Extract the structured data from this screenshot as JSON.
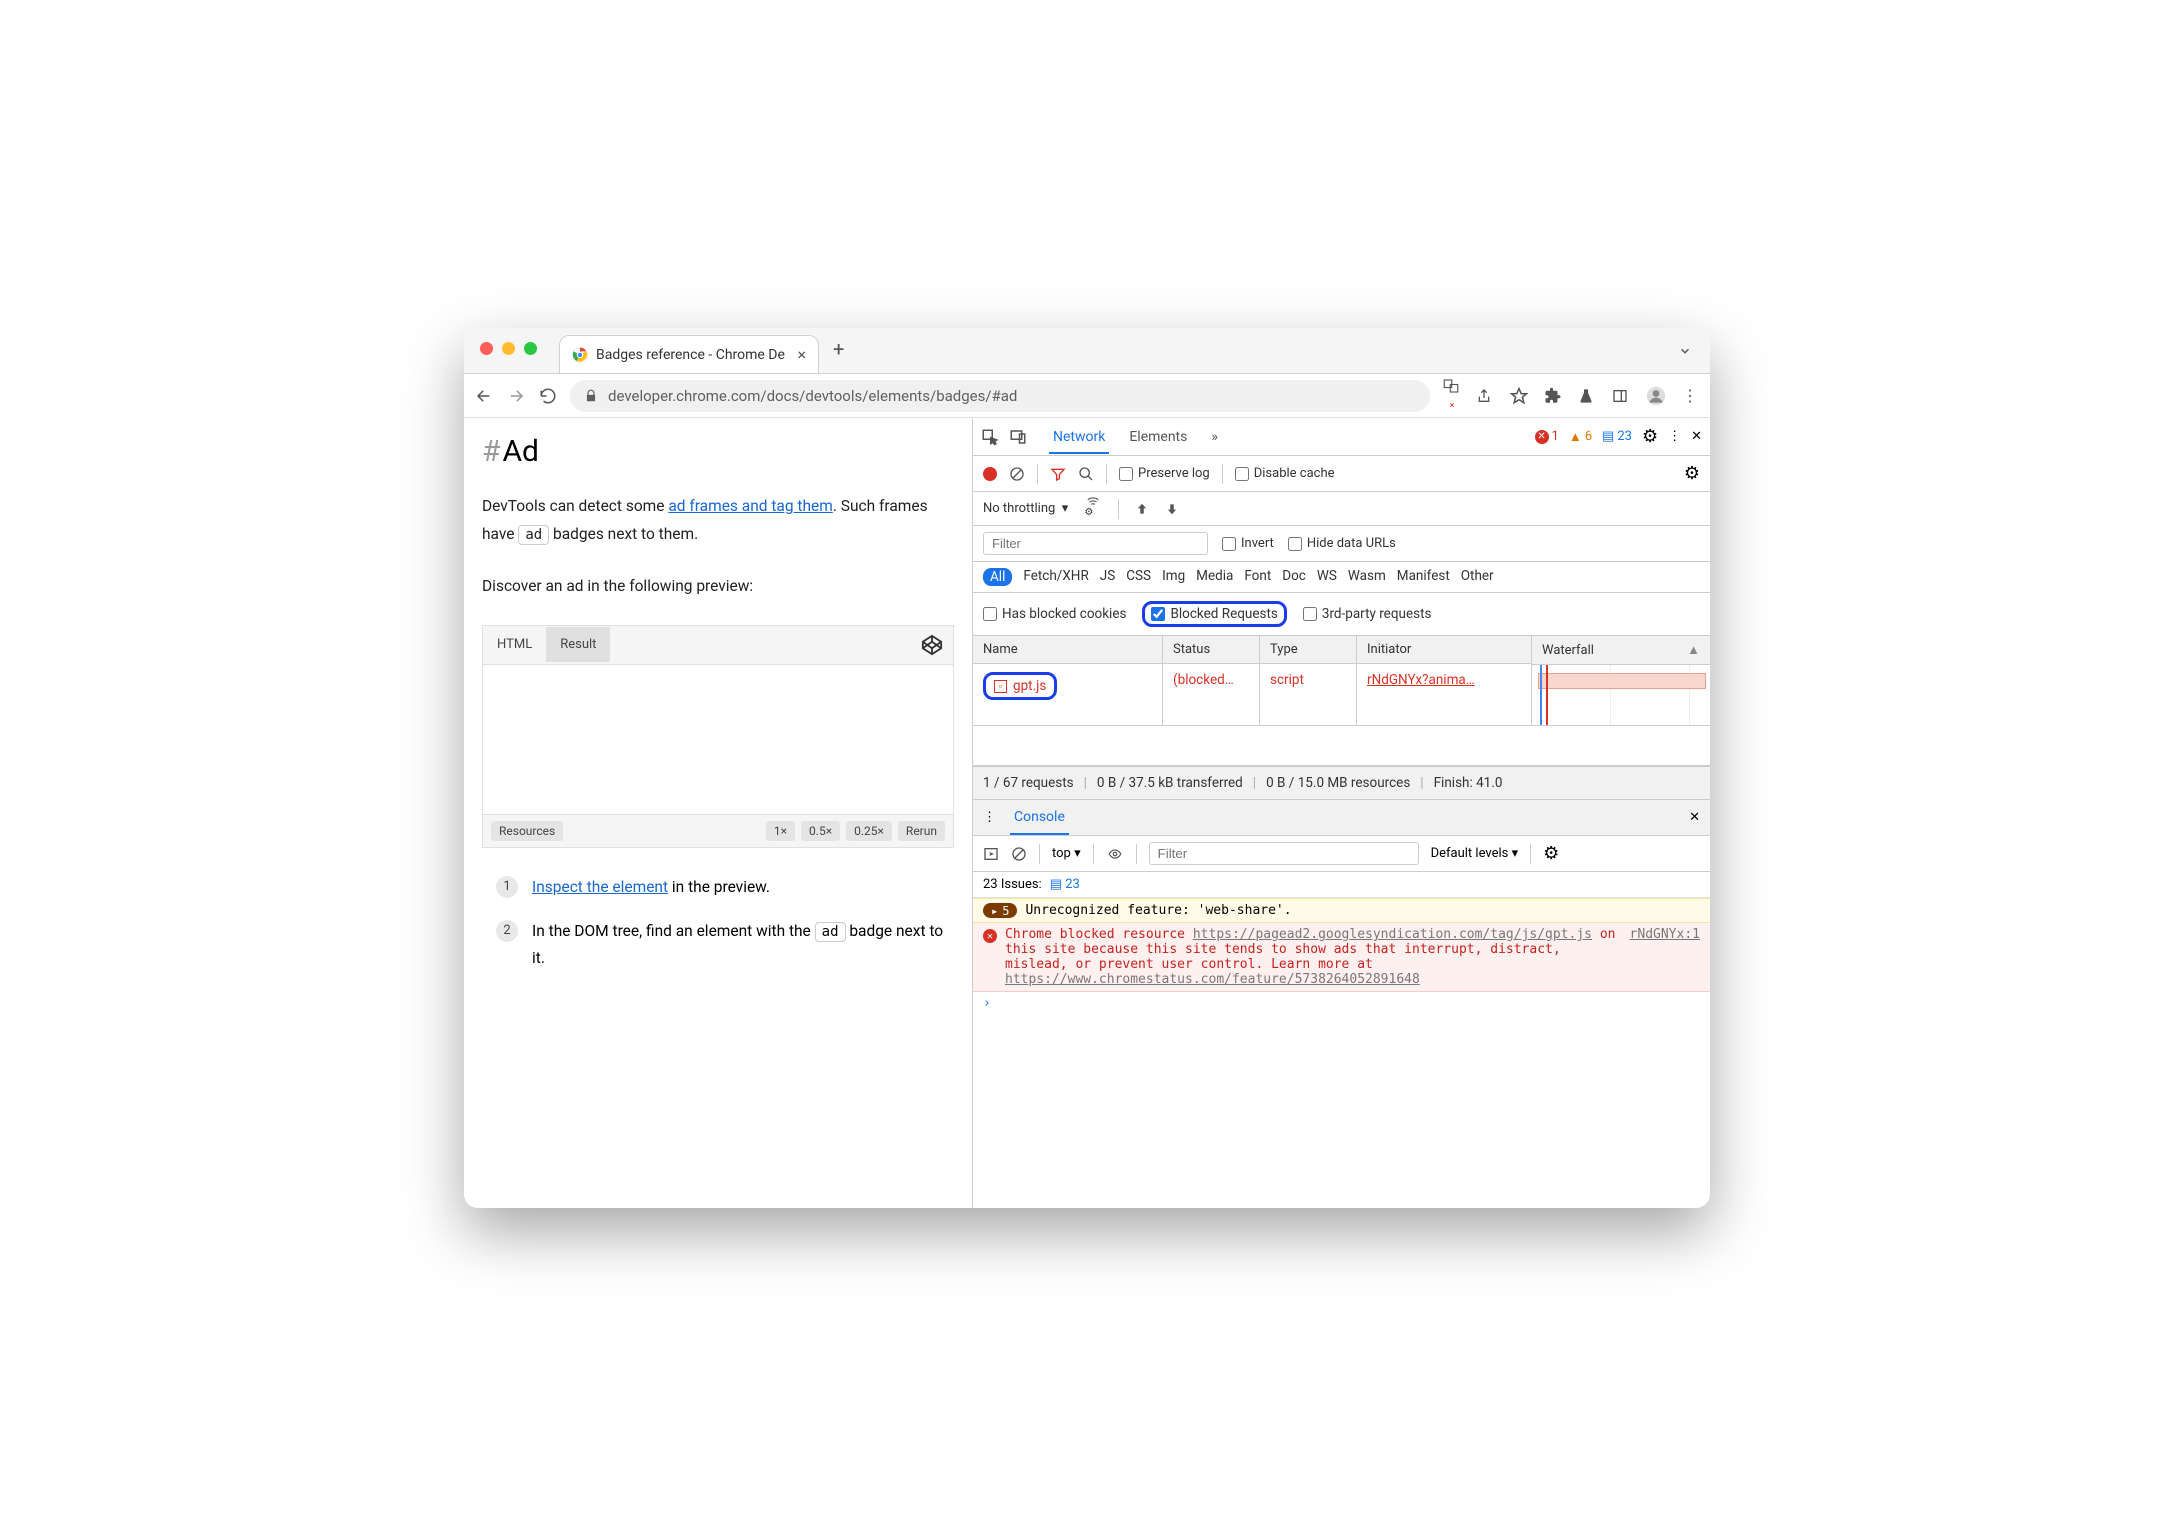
{
  "browser": {
    "tab_title": "Badges reference - Chrome De",
    "url": "developer.chrome.com/docs/devtools/elements/badges/#ad"
  },
  "doc": {
    "heading": "Ad",
    "p1_a": "DevTools can detect some ",
    "p1_link": "ad frames and tag them",
    "p1_b": ". Such frames have ",
    "p1_badge": "ad",
    "p1_c": " badges next to them.",
    "p2": "Discover an ad in the following preview:",
    "codepen": {
      "tab_html": "HTML",
      "tab_result": "Result",
      "btn_resources": "Resources",
      "btn_1x": "1×",
      "btn_05x": "0.5×",
      "btn_025x": "0.25×",
      "btn_rerun": "Rerun"
    },
    "step1_a": "Inspect the element",
    "step1_b": " in the preview.",
    "step2_a": "In the DOM tree, find an element with the ",
    "step2_badge": "ad",
    "step2_b": " badge next to it."
  },
  "devtools": {
    "tab_network": "Network",
    "tab_elements": "Elements",
    "errors": "1",
    "warnings": "6",
    "messages": "23",
    "preserve_log": "Preserve log",
    "disable_cache": "Disable cache",
    "throttle": "No throttling",
    "filter_ph": "Filter",
    "invert": "Invert",
    "hide_urls": "Hide data URLs",
    "types": {
      "all": "All",
      "fetch": "Fetch/XHR",
      "js": "JS",
      "css": "CSS",
      "img": "Img",
      "media": "Media",
      "font": "Font",
      "doc": "Doc",
      "ws": "WS",
      "wasm": "Wasm",
      "manifest": "Manifest",
      "other": "Other"
    },
    "has_blocked": "Has blocked cookies",
    "blocked_req": "Blocked Requests",
    "third_party": "3rd-party requests",
    "cols": {
      "name": "Name",
      "status": "Status",
      "type": "Type",
      "initiator": "Initiator",
      "waterfall": "Waterfall"
    },
    "row": {
      "name": "gpt.js",
      "status": "(blocked…",
      "type": "script",
      "initiator": "rNdGNYx?anima…"
    },
    "summary": {
      "req": "1 / 67 requests",
      "xfer": "0 B / 37.5 kB transferred",
      "res": "0 B / 15.0 MB resources",
      "finish": "Finish: 41.0"
    },
    "console": {
      "title": "Console",
      "top": "top",
      "default_levels": "Default levels",
      "issues_label": "23 Issues:",
      "issues_count": "23",
      "warn_count": "5",
      "warn_text": "Unrecognized feature: 'web-share'.",
      "err_a": "Chrome blocked resource ",
      "err_url1": "https://pagead2.googlesyndication.com/tag/js/gpt.js",
      "err_b": " on this site because this site tends to show ads that interrupt, distract, mislead, or prevent user control. Learn more at ",
      "err_url2": "https://www.chromestatus.com/feature/5738264052891648",
      "err_src": "rNdGNYx:1"
    }
  }
}
